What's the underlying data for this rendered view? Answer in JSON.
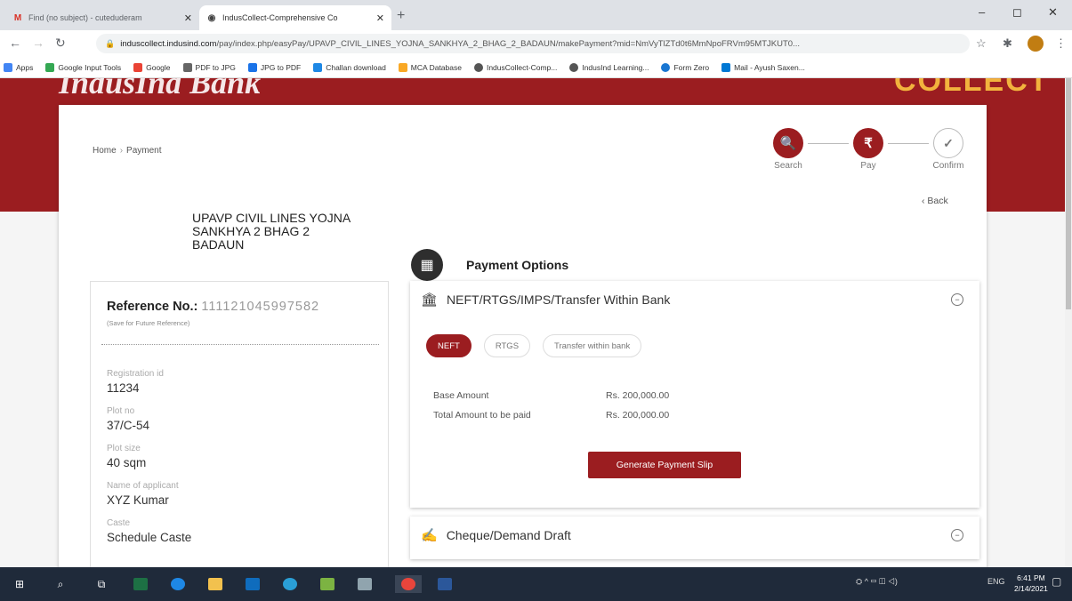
{
  "browser": {
    "tabs": [
      {
        "title": "Find (no subject) - cuteduderam",
        "close": "✕"
      },
      {
        "title": "IndusCollect-Comprehensive Co",
        "close": "✕"
      }
    ],
    "new_tab": "+",
    "window_controls": {
      "minimize": "–",
      "maximize": "◻",
      "close": "✕"
    },
    "nav": {
      "back": "←",
      "forward": "→",
      "reload": "↻"
    },
    "url_domain": "induscollect.indusind.com",
    "url_path": "/pay/index.php/easyPay/UPAVP_CIVIL_LINES_YOJNA_SANKHYA_2_BHAG_2_BADAUN/makePayment?mid=NmVyTlZTd0t6MmNpoFRVm95MTJKUT0...",
    "bookmarks": [
      {
        "label": "Apps",
        "color": "#4285f4"
      },
      {
        "label": "Google Input Tools",
        "color": "#34a853"
      },
      {
        "label": "Google",
        "color": "#ea4335"
      },
      {
        "label": "PDF to JPG",
        "color": "#666666"
      },
      {
        "label": "JPG to PDF",
        "color": "#1a73e8"
      },
      {
        "label": "Challan download",
        "color": "#1e88e5"
      },
      {
        "label": "MCA Database",
        "color": "#f9a825"
      },
      {
        "label": "IndusCollect-Comp...",
        "color": "#555555"
      },
      {
        "label": "IndusInd Learning...",
        "color": "#555555"
      },
      {
        "label": "Form Zero",
        "color": "#1976d2"
      },
      {
        "label": "Mail - Ayush Saxen...",
        "color": "#0078d4"
      }
    ]
  },
  "header": {
    "brand_left": "IndusInd Bank",
    "brand_right": "COLLECT"
  },
  "breadcrumb": {
    "home": "Home",
    "separator": "›",
    "current": "Payment"
  },
  "steps": [
    {
      "label": "Search",
      "glyph": "🔍",
      "state": "done"
    },
    {
      "label": "Pay",
      "glyph": "₹",
      "state": "active"
    },
    {
      "label": "Confirm",
      "glyph": "✓",
      "state": "pending"
    }
  ],
  "back_link": "‹ Back",
  "entity": {
    "lines": [
      "UPAVP CIVIL LINES YOJNA",
      "SANKHYA 2 BHAG 2",
      "BADAUN"
    ]
  },
  "reference": {
    "label": "Reference No.:",
    "value": "1111210459975​82",
    "note": "(Save for Future Reference)"
  },
  "fields": [
    {
      "label": "Registration id",
      "value": "11234"
    },
    {
      "label": "Plot no",
      "value": "37/C-54"
    },
    {
      "label": "Plot size",
      "value": "40 sqm"
    },
    {
      "label": "Name of applicant",
      "value": "XYZ Kumar"
    },
    {
      "label": "Caste",
      "value": "Schedule Caste"
    }
  ],
  "payment": {
    "title": "Payment Options",
    "section1": {
      "title": "NEFT/RTGS/IMPS/Transfer Within Bank",
      "pills": [
        {
          "label": "NEFT",
          "active": true
        },
        {
          "label": "RTGS",
          "active": false
        },
        {
          "label": "Transfer within bank",
          "active": false
        }
      ],
      "base_label": "Base Amount",
      "base_value": "Rs. 200,000.00",
      "total_label": "Total Amount to be paid",
      "total_value": "Rs. 200,000.00",
      "button": "Generate Payment Slip"
    },
    "section2": {
      "title": "Cheque/Demand Draft"
    }
  },
  "taskbar": {
    "clock_time": "6:41 PM",
    "clock_date": "2/14/2021",
    "lang": "ENG"
  },
  "colors": {
    "brand_red": "#9b1d20",
    "brand_gold": "#f2b33d"
  }
}
